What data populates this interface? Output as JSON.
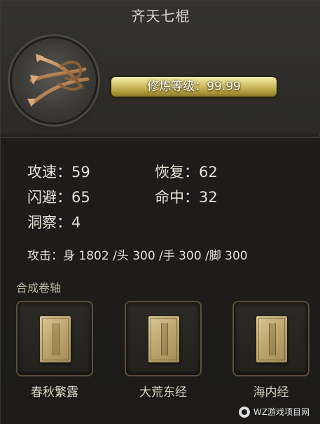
{
  "title": "齐天七棍",
  "level": {
    "label": "修炼等级：99.99"
  },
  "stats": [
    {
      "label": "攻速：59"
    },
    {
      "label": "恢复：62"
    },
    {
      "label": "闪避：65"
    },
    {
      "label": "命中：32"
    },
    {
      "label": "洞察：4"
    }
  ],
  "attack": "攻击：身 1802 /头 300 /手 300 /脚 300",
  "section_label": "合成卷轴",
  "scrolls": [
    {
      "name": "春秋繁露"
    },
    {
      "name": "大荒东经"
    },
    {
      "name": "海内经"
    }
  ],
  "watermark": "WZ游戏项目网",
  "colors": {
    "gold_bar": "#d8ca72",
    "text": "#e6e2d8",
    "slot_border": "#5a4f3a"
  },
  "icons": {
    "emblem": "crossed-arrows-icon",
    "scroll": "book-scroll-icon"
  }
}
